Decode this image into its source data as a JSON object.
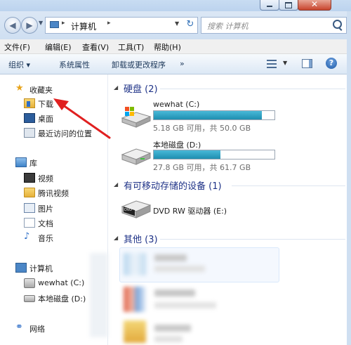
{
  "address_bar": {
    "path": [
      "计算机"
    ],
    "search_placeholder": "搜索 计算机"
  },
  "menu": [
    {
      "label": "文件(F)"
    },
    {
      "label": "编辑(E)"
    },
    {
      "label": "查看(V)"
    },
    {
      "label": "工具(T)"
    },
    {
      "label": "帮助(H)"
    }
  ],
  "toolbar": {
    "organize": "组织 ▾",
    "system_properties": "系统属性",
    "uninstall": "卸载或更改程序",
    "more": "»"
  },
  "nav": {
    "favorites": "收藏夹",
    "downloads": "下载",
    "desktop": "桌面",
    "recent": "最近访问的位置",
    "libraries": "库",
    "videos": "视频",
    "tencent_video": "腾讯视频",
    "pictures": "图片",
    "documents": "文档",
    "music": "音乐",
    "computer": "计算机",
    "drive_c": "wewhat (C:)",
    "drive_d": "本地磁盘 (D:)",
    "network": "网络"
  },
  "groups": {
    "hard_disks": "硬盘 (2)",
    "removable": "有可移动存储的设备 (1)",
    "other": "其他 (3)"
  },
  "drives": [
    {
      "name": "wewhat (C:)",
      "free": "5.18 GB 可用，共 50.0 GB",
      "used_fraction": 0.896
    },
    {
      "name": "本地磁盘 (D:)",
      "free": "27.8 GB 可用，共 61.7 GB",
      "used_fraction": 0.55
    }
  ],
  "dvd": {
    "name": "DVD RW 驱动器 (E:)",
    "badge": "DVD"
  },
  "colors": {
    "annotation_arrow": "#e02020",
    "usage_bar": "#2aa0c4",
    "group_header": "#1e3287"
  }
}
